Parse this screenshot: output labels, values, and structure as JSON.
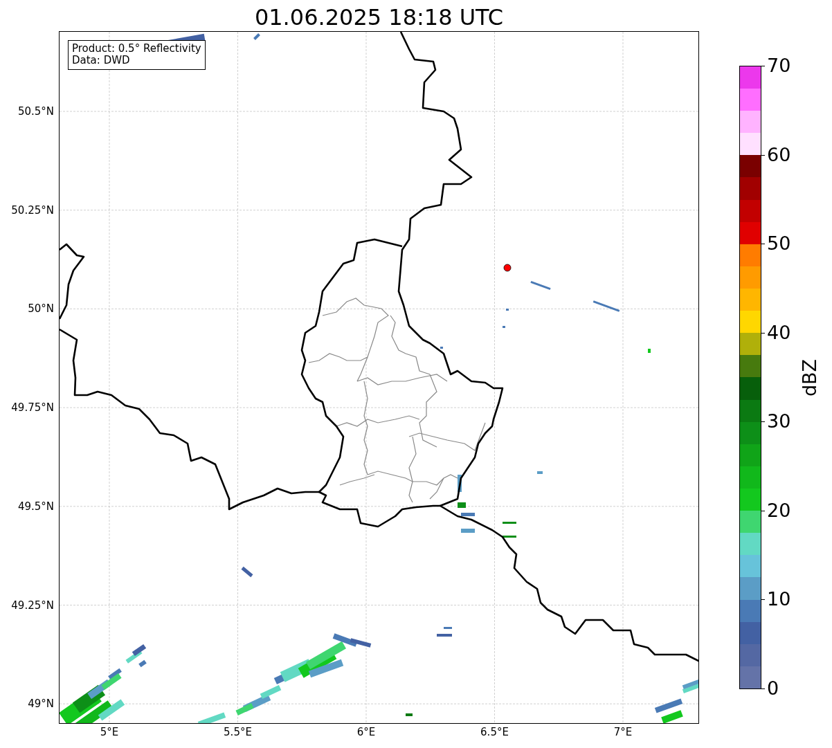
{
  "title": "01.06.2025 18:18 UTC",
  "info_box": [
    "Product: 0.5° Reflectivity",
    "Data: DWD"
  ],
  "map": {
    "kind": "map",
    "lat_labels": [
      "50.5°N",
      "50.25°N",
      "50°N",
      "49.75°N",
      "49.5°N",
      "49.25°N",
      "49°N"
    ],
    "lon_labels": [
      "5°E",
      "5.5°E",
      "6°E",
      "6.5°E",
      "7°E"
    ]
  },
  "colorbar": {
    "label": "dBZ",
    "ticks": [
      "70",
      "60",
      "50",
      "40",
      "30",
      "20",
      "10",
      "0"
    ],
    "bins": [
      {
        "color": "#6473a8"
      },
      {
        "color": "#5468a3"
      },
      {
        "color": "#4361a3"
      },
      {
        "color": "#4a7ab5"
      },
      {
        "color": "#5b9dc6"
      },
      {
        "color": "#67c3da"
      },
      {
        "color": "#62d9c3"
      },
      {
        "color": "#3fd670"
      },
      {
        "color": "#13c81e"
      },
      {
        "color": "#11b81b"
      },
      {
        "color": "#10a418"
      },
      {
        "color": "#0d8f18"
      },
      {
        "color": "#0b7a12"
      },
      {
        "color": "#075f0b"
      },
      {
        "color": "#477a0e"
      },
      {
        "color": "#b0b00a"
      },
      {
        "color": "#ffd700"
      },
      {
        "color": "#ffb600"
      },
      {
        "color": "#ff9b00"
      },
      {
        "color": "#ff7c00"
      },
      {
        "color": "#e00000"
      },
      {
        "color": "#c20000"
      },
      {
        "color": "#a10000"
      },
      {
        "color": "#7a0000"
      },
      {
        "color": "#ffe0ff"
      },
      {
        "color": "#ffb3ff"
      },
      {
        "color": "#ff6eff"
      },
      {
        "color": "#ec38ec"
      }
    ]
  }
}
